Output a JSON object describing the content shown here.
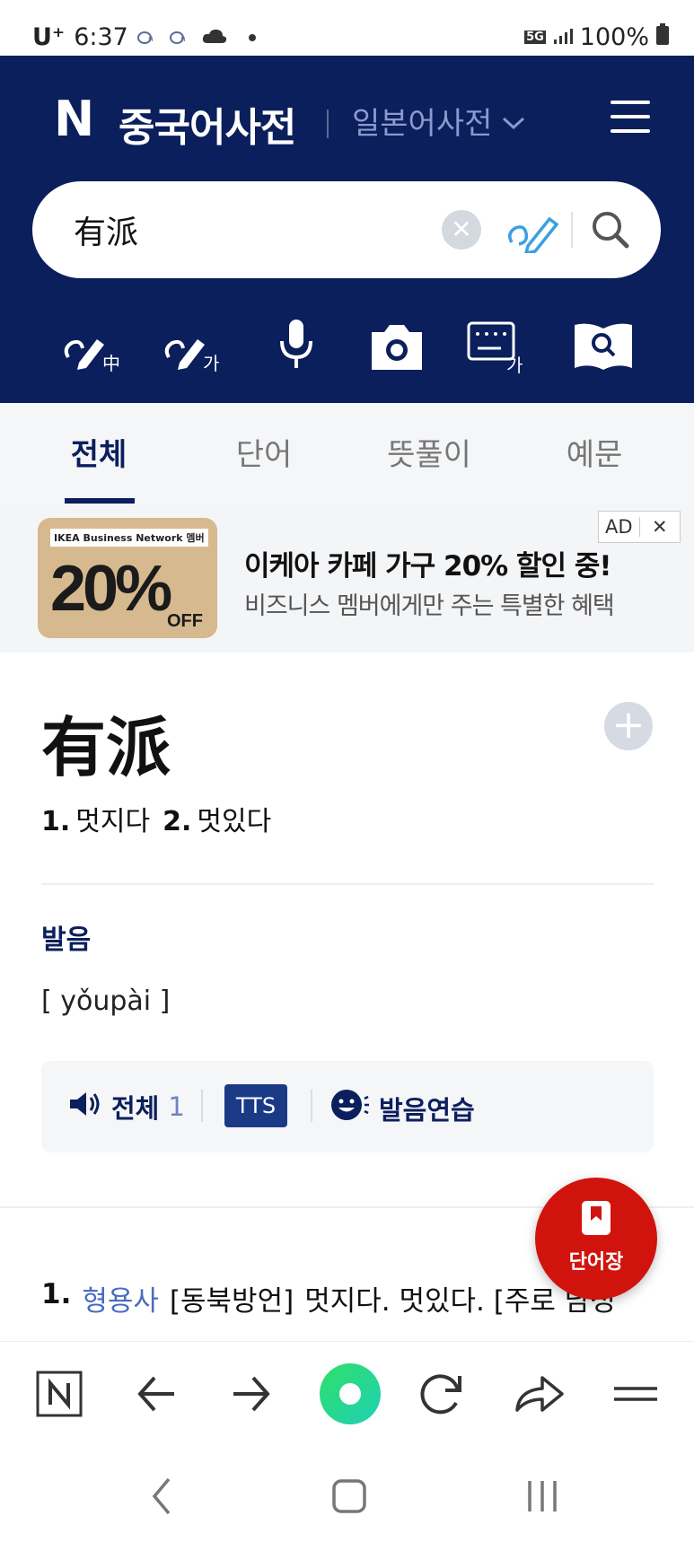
{
  "status_bar": {
    "carrier": "U⁺",
    "time": "6:37",
    "network": "5G",
    "battery": "100%"
  },
  "header": {
    "logo": "N",
    "title": "중국어사전",
    "switch_label": "일본어사전",
    "search": {
      "value": "有派",
      "placeholder": ""
    }
  },
  "tools": [
    "handwriting-chinese-icon",
    "handwriting-korean-icon",
    "voice-icon",
    "camera-icon",
    "keyboard-korean-icon",
    "book-search-icon"
  ],
  "tabs": [
    {
      "label": "전체",
      "active": true
    },
    {
      "label": "단어",
      "active": false
    },
    {
      "label": "뜻풀이",
      "active": false
    },
    {
      "label": "예문",
      "active": false
    }
  ],
  "ad": {
    "image_label": "IKEA Business Network 멤버",
    "image_percent": "20%",
    "image_off": "OFF",
    "title": "이케아 카페 가구 20% 할인 중!",
    "subtitle": "비즈니스 멤버에게만 주는 특별한 혜택",
    "badge": "AD",
    "close": "✕"
  },
  "entry": {
    "word": "有派",
    "meaning1_num": "1.",
    "meaning1": "멋지다",
    "meaning2_num": "2.",
    "meaning2": "멋있다",
    "pronunciation_title": "발음",
    "pinyin": "[ yǒupài ]",
    "audio_all_label": "전체",
    "audio_all_count": "1",
    "tts_label": "TTS",
    "practice_label": "발음연습",
    "definition": {
      "num": "1.",
      "pos": "형용사",
      "region": "[동북방언]",
      "text": "멋지다. 멋있다. [주로 남성"
    }
  },
  "fab_label": "단어장",
  "browser_buttons": [
    "naver-home-icon",
    "back-arrow-icon",
    "forward-arrow-icon",
    "green-dot-icon",
    "refresh-icon",
    "share-icon",
    "menu-icon"
  ]
}
